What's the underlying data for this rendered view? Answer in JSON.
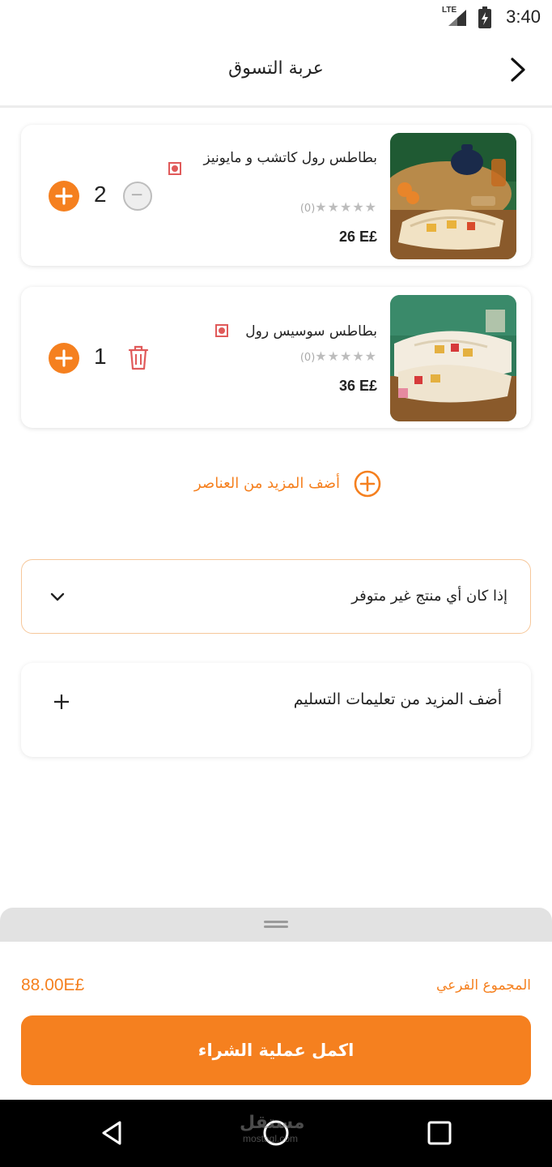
{
  "status_bar": {
    "time": "3:40",
    "network": "LTE"
  },
  "header": {
    "title": "عربة التسوق"
  },
  "cart": {
    "items": [
      {
        "name": "بطاطس رول كاتشب و مايونيز",
        "rating_count": "(0)",
        "price": "26 E£",
        "quantity": "2"
      },
      {
        "name": "بطاطس سوسيس رول",
        "rating_count": "(0)",
        "price": "36 E£",
        "quantity": "1"
      }
    ]
  },
  "add_more_items": {
    "label": "أضف المزيد من العناصر"
  },
  "unavailable_option": {
    "label": "إذا كان أي منتج غير متوفر"
  },
  "delivery_instructions": {
    "label": "أضف المزيد من تعليمات التسليم"
  },
  "summary": {
    "subtotal_label": "المجموع الفرعي",
    "subtotal_value": "88.00E£"
  },
  "checkout": {
    "label": "اكمل عملية الشراء"
  },
  "watermark": {
    "text": "مستقل",
    "subtext": "mostaql.com"
  },
  "colors": {
    "accent": "#f5801f",
    "danger": "#e05a5a",
    "veg_badge": "#e05a5a"
  }
}
